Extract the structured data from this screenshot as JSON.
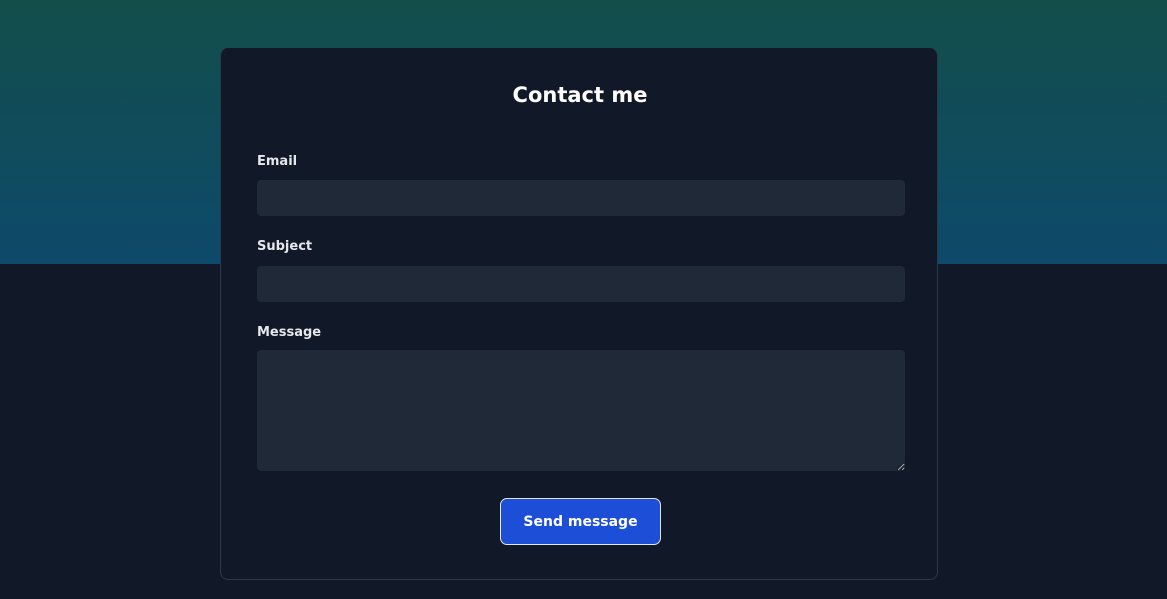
{
  "contact_form": {
    "title": "Contact me",
    "email": {
      "label": "Email",
      "value": ""
    },
    "subject": {
      "label": "Subject",
      "value": ""
    },
    "message": {
      "label": "Message",
      "value": ""
    },
    "submit_label": "Send message"
  },
  "colors": {
    "page_background": "#111827",
    "hero_gradient_top": "#134e4a",
    "hero_gradient_bottom": "#0d4a6b",
    "card_background": "#111827",
    "input_background": "#1f2937",
    "button_background": "#1d4ed8"
  }
}
